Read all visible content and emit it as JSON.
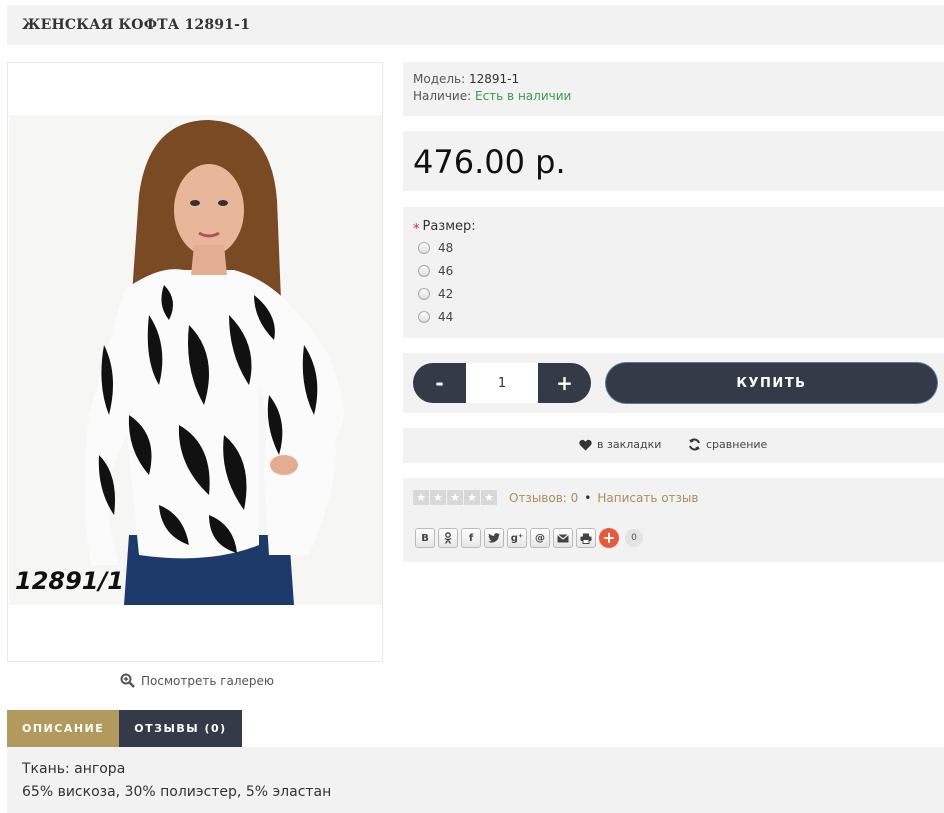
{
  "product": {
    "title": "ЖЕНСКАЯ КОФТА 12891-1",
    "image_code": "12891/1",
    "gallery_link": "Посмотреть галерею"
  },
  "info": {
    "model_label": "Модель:",
    "model_value": "12891-1",
    "stock_label": "Наличие:",
    "stock_value": "Есть в наличии"
  },
  "price": "476.00 р.",
  "options": {
    "required_mark": "*",
    "size_label": "Размер:",
    "sizes": [
      "48",
      "46",
      "42",
      "44"
    ]
  },
  "cart": {
    "minus_label": "-",
    "qty_value": "1",
    "plus_label": "+",
    "buy_label": "КУПИТЬ"
  },
  "actions": {
    "wishlist_label": "в закладки",
    "compare_label": "сравнение"
  },
  "reviews": {
    "count_label": "Отзывов: 0",
    "separator": "•",
    "write_label": "Написать отзыв"
  },
  "share": {
    "buttons": [
      "В",
      "ok",
      "f",
      "tw",
      "g+",
      "@",
      "mail",
      "print"
    ],
    "count": "0"
  },
  "tabs": {
    "description": "ОПИСАНИЕ",
    "reviews": "ОТЗЫВЫ (0)"
  },
  "description": {
    "line1": "Ткань: ангора",
    "line2": "65% вискоза, 30% полиэстер, 5% эластан"
  },
  "colors": {
    "accent_gold": "#b29a5f",
    "dark_button": "#343a48",
    "in_stock_green": "#3a9a4a",
    "link_gold": "#a8905a",
    "panel_bg": "#f2f2f2"
  }
}
